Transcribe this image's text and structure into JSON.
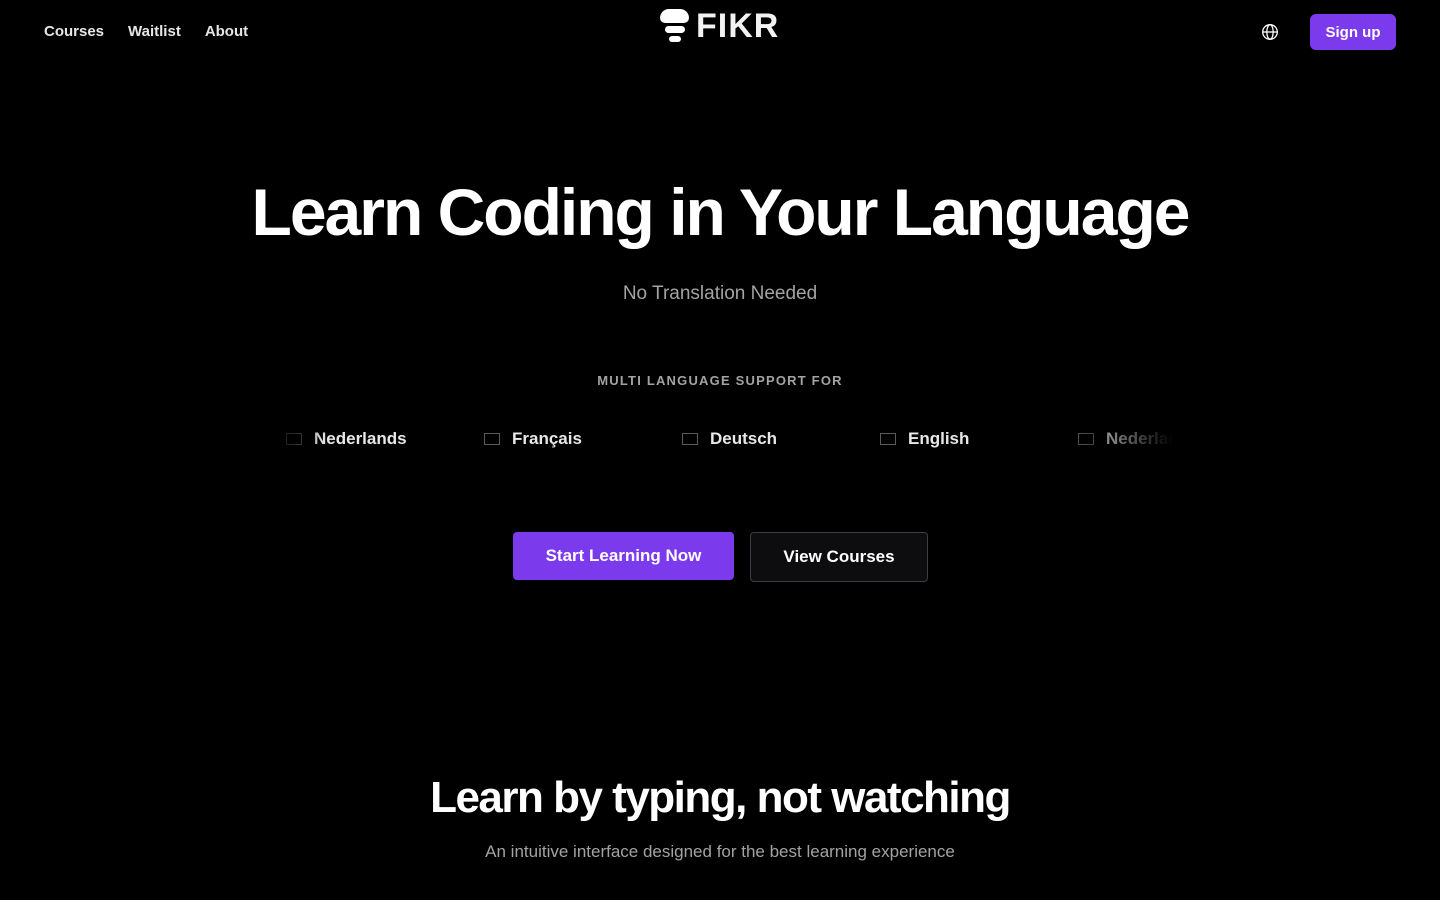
{
  "header": {
    "nav": [
      {
        "label": "Courses"
      },
      {
        "label": "Waitlist"
      },
      {
        "label": "About"
      }
    ],
    "logo_text": "FIKR",
    "language_icon": "globe-icon",
    "signup_label": "Sign up"
  },
  "hero": {
    "title": "Learn Coding in Your Language",
    "subtitle": "No Translation Needed",
    "support_label": "MULTI LANGUAGE SUPPORT FOR",
    "languages": [
      {
        "label": "Nederlands",
        "icon": "flag-icon"
      },
      {
        "label": "Français",
        "icon": "flag-icon"
      },
      {
        "label": "Deutsch",
        "icon": "flag-icon"
      },
      {
        "label": "English",
        "icon": "flag-icon"
      },
      {
        "label": "Nederlands",
        "icon": "flag-icon"
      }
    ],
    "primary_cta": "Start Learning Now",
    "secondary_cta": "View Courses"
  },
  "feature": {
    "title": "Learn by typing, not watching",
    "subtitle": "An intuitive interface designed for the best learning experience"
  },
  "colors": {
    "background": "#000000",
    "accent": "#7c3aed",
    "muted_text": "#a3a3a3"
  }
}
